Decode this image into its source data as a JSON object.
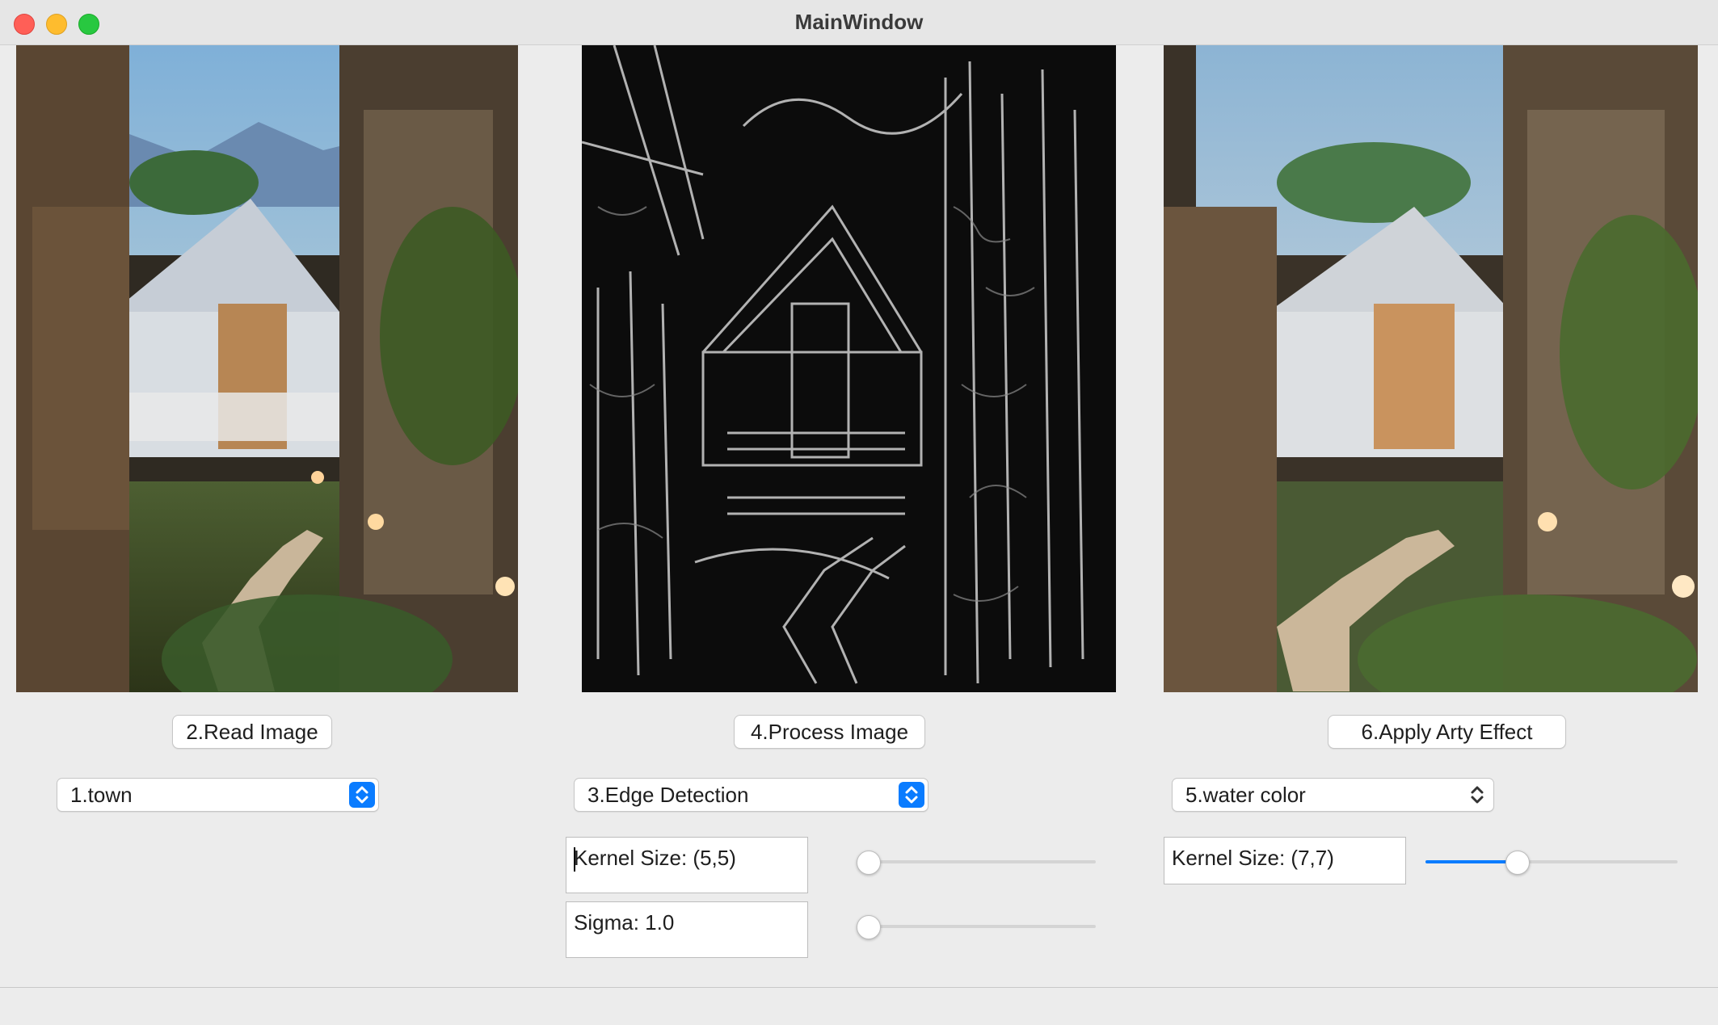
{
  "window": {
    "title": "MainWindow"
  },
  "images": {
    "original": "town photo (path, tent house, stone walls)",
    "edges": "edge detection result",
    "arty": "water color effect result"
  },
  "buttons": {
    "read": "2.Read Image",
    "process": "4.Process Image",
    "arty": "6.Apply Arty Effect"
  },
  "selects": {
    "image": "1.town",
    "process": "3.Edge Detection",
    "effect": "5.water color"
  },
  "params": {
    "kernel_label": "Kernel Size: (5,5)",
    "sigma_label": "Sigma: 1.0",
    "arty_kernel_label": "Kernel Size: (7,7)",
    "kernel_slider": 0.0,
    "sigma_slider": 0.0,
    "arty_kernel_slider": 0.35
  },
  "colors": {
    "accent": "#0a7cff"
  }
}
